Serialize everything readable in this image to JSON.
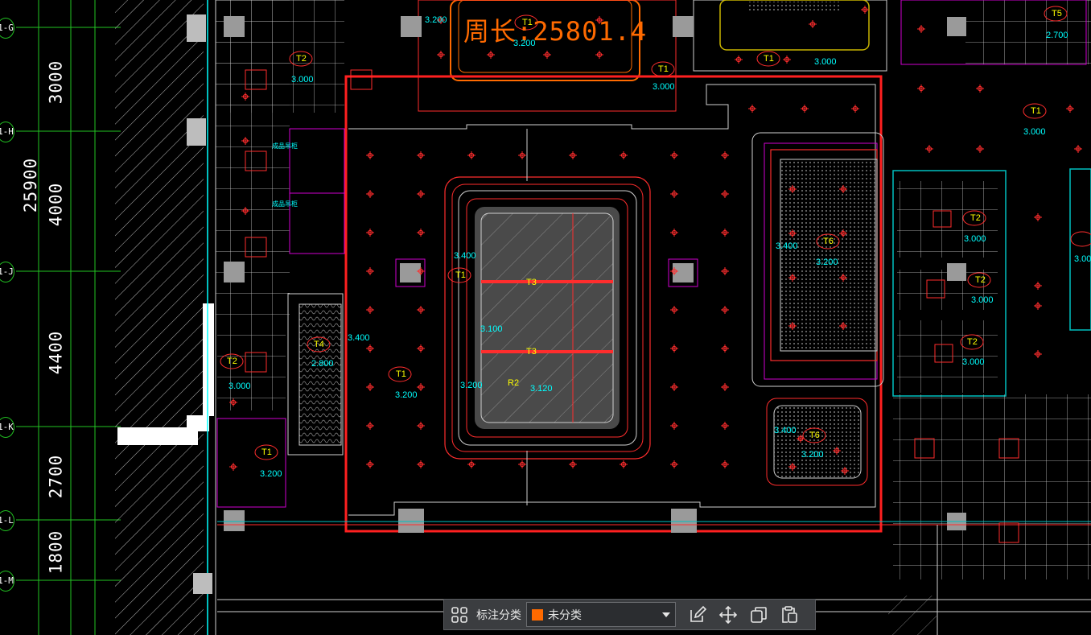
{
  "drawing": {
    "dimensions": [
      "3000",
      "25900",
      "4000",
      "4400",
      "2700",
      "1800"
    ],
    "axis_bubbles": [
      "1-G",
      "1-H",
      "1-J",
      "1-K",
      "1-L",
      "1-M"
    ],
    "room_tags": {
      "t2_top": "T2",
      "t1_top": "T1",
      "t1_topright": "T1",
      "t5": "T5",
      "t1_right": "T1",
      "t1_main": "T1",
      "t1_center": "T1",
      "t3_a": "T3",
      "t3_b": "T3",
      "r2": "R2",
      "t6_a": "T6",
      "t6_b": "T6",
      "t2_r1": "T2",
      "t2_r2": "T2",
      "t2_r3": "T2",
      "t4": "T4",
      "t2_left": "T2",
      "t1_bottomleft": "T1",
      "t1_edge": "T1"
    },
    "elevations": {
      "e_3200_top": "3.200",
      "e_3000_t2": "3.000",
      "e_3200_top2": "3.200",
      "e_3000_topright": "3.000",
      "e_2700": "2.700",
      "e_3000_t1top": "3.000",
      "e_3000_right": "3.000",
      "e_3400_center": "3.400",
      "e_3400_t6": "3.400",
      "e_3200_t6": "3.200",
      "e_3000_t2r1": "3.000",
      "e_3000_t2r2": "3.000",
      "e_3000_t2r3": "3.000",
      "e_3100": "3.100",
      "e_3400_t4": "3.400",
      "e_2800": "2.800",
      "e_3000_left": "3.000",
      "e_3200_main": "3.200",
      "e_3200_center": "3.200",
      "e_3120": "3.120",
      "e_3400_t6b": "3.400",
      "e_3200_t6b": "3.200",
      "e_3200_bl": "3.200",
      "e_3000_edge": "3.000"
    },
    "top_text": "周长:25801.4",
    "chinese_notes": [
      "成品吊柜",
      "成品吊柜"
    ],
    "colors": {
      "highlight_rect": "#ff2020",
      "axis": "#22c322",
      "tag": "#ffff00",
      "elevation": "#00ffff",
      "wall": "#ff2d2d",
      "magenta": "#d000d0"
    }
  },
  "toolbar": {
    "grid_icon": "grid-icon",
    "label": "标注分类",
    "select_value": "未分类",
    "select_swatch": "#ff6a00",
    "actions": [
      "edit-icon",
      "move-icon",
      "copy-icon",
      "paste-icon"
    ]
  }
}
